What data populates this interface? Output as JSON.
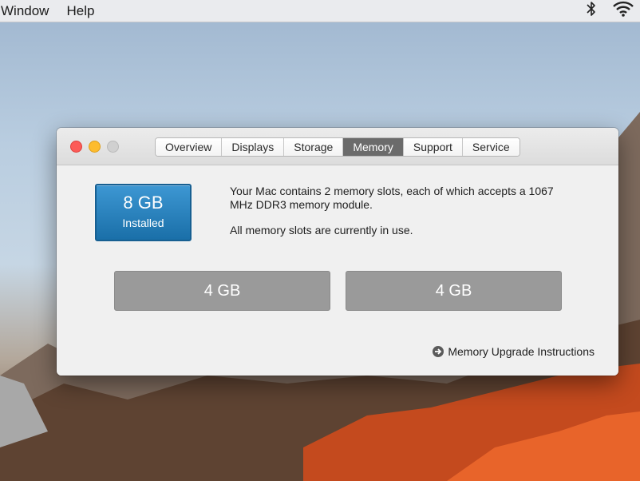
{
  "menubar": {
    "items": [
      "Window",
      "Help"
    ],
    "status_icons": [
      "bluetooth-icon",
      "wifi-icon"
    ]
  },
  "window": {
    "tabs": [
      {
        "label": "Overview",
        "active": false
      },
      {
        "label": "Displays",
        "active": false
      },
      {
        "label": "Storage",
        "active": false
      },
      {
        "label": "Memory",
        "active": true
      },
      {
        "label": "Support",
        "active": false
      },
      {
        "label": "Service",
        "active": false
      }
    ]
  },
  "memory": {
    "installed_size": "8 GB",
    "installed_label": "Installed",
    "description_line1": "Your Mac contains 2 memory slots, each of which accepts a 1067 MHz DDR3 memory module.",
    "description_line2": "All memory slots are currently in use.",
    "slots": [
      "4 GB",
      "4 GB"
    ],
    "upgrade_link": "Memory Upgrade Instructions"
  },
  "colors": {
    "installed_badge": "#2a83c0",
    "slot_fill": "#9a9a9a",
    "active_tab": "#6b6b6b",
    "traffic_close": "#fc5b57",
    "traffic_minimize": "#fdbc2e"
  }
}
